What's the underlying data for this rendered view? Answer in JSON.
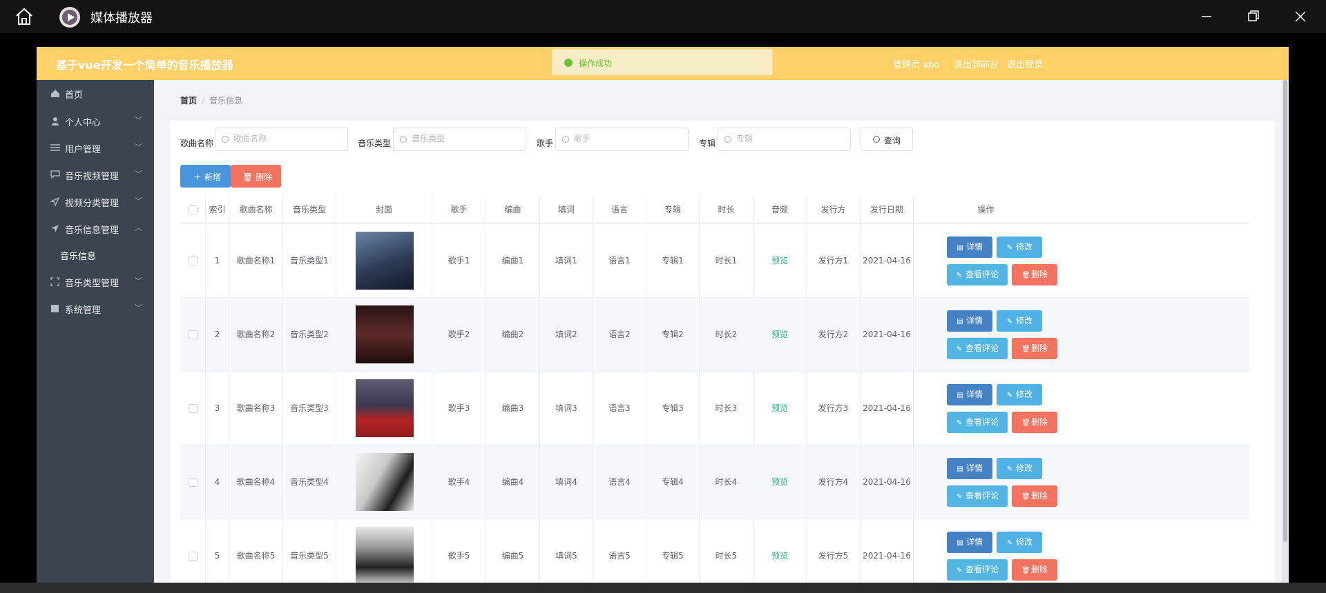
{
  "player": {
    "title": "媒体播放器"
  },
  "site": {
    "title": "基于vue开发一个简单的音乐播放器",
    "toast": "操作成功",
    "header_links": [
      "管理员 abo",
      "退出到前台",
      "退出登录"
    ]
  },
  "sidebar": {
    "items": [
      {
        "label": "首页",
        "icon": "home-icon"
      },
      {
        "label": "个人中心",
        "icon": "user-icon"
      },
      {
        "label": "用户管理",
        "icon": "sliders-icon"
      },
      {
        "label": "音乐视频管理",
        "icon": "chat-icon"
      },
      {
        "label": "视频分类管理",
        "icon": "send-icon"
      },
      {
        "label": "音乐信息管理",
        "icon": "send-icon"
      },
      {
        "label": "音乐类型管理",
        "icon": "expand-icon"
      },
      {
        "label": "系统管理",
        "icon": "grid-icon"
      }
    ],
    "active_sub": "音乐信息"
  },
  "breadcrumb": {
    "home": "首页",
    "current": "音乐信息"
  },
  "search": {
    "fields": [
      {
        "label": "歌曲名称",
        "placeholder": "歌曲名称"
      },
      {
        "label": "音乐类型",
        "placeholder": "音乐类型"
      },
      {
        "label": "歌手",
        "placeholder": "歌手"
      },
      {
        "label": "专辑",
        "placeholder": "专辑"
      }
    ],
    "button": "查询"
  },
  "toolbar": {
    "add": "新增",
    "delete": "删除"
  },
  "table": {
    "columns": [
      "索引",
      "歌曲名称",
      "音乐类型",
      "封面",
      "歌手",
      "编曲",
      "填词",
      "语言",
      "专辑",
      "时长",
      "音频",
      "发行方",
      "发行日期",
      "操作"
    ],
    "rows": [
      {
        "idx": "1",
        "song": "歌曲名称1",
        "type": "音乐类型1",
        "singer": "歌手1",
        "arr": "编曲1",
        "lyric": "填词1",
        "lang": "语言1",
        "album": "专辑1",
        "dur": "时长1",
        "audio": "预览",
        "pub": "发行方1",
        "date": "2021-04-16"
      },
      {
        "idx": "2",
        "song": "歌曲名称2",
        "type": "音乐类型2",
        "singer": "歌手2",
        "arr": "编曲2",
        "lyric": "填词2",
        "lang": "语言2",
        "album": "专辑2",
        "dur": "时长2",
        "audio": "预览",
        "pub": "发行方2",
        "date": "2021-04-16"
      },
      {
        "idx": "3",
        "song": "歌曲名称3",
        "type": "音乐类型3",
        "singer": "歌手3",
        "arr": "编曲3",
        "lyric": "填词3",
        "lang": "语言3",
        "album": "专辑3",
        "dur": "时长3",
        "audio": "预览",
        "pub": "发行方3",
        "date": "2021-04-16"
      },
      {
        "idx": "4",
        "song": "歌曲名称4",
        "type": "音乐类型4",
        "singer": "歌手4",
        "arr": "编曲4",
        "lyric": "填词4",
        "lang": "语言4",
        "album": "专辑4",
        "dur": "时长4",
        "audio": "预览",
        "pub": "发行方4",
        "date": "2021-04-16"
      },
      {
        "idx": "5",
        "song": "歌曲名称5",
        "type": "音乐类型5",
        "singer": "歌手5",
        "arr": "编曲5",
        "lyric": "填词5",
        "lang": "语言5",
        "album": "专辑5",
        "dur": "时长5",
        "audio": "预览",
        "pub": "发行方5",
        "date": "2021-04-16"
      }
    ],
    "actions": {
      "detail": "详情",
      "edit": "修改",
      "comments": "查看评论",
      "remove": "删除"
    }
  },
  "colors": {
    "header": "#fdd168",
    "sidebar": "#3c4450",
    "primary": "#4796db",
    "danger": "#f37260",
    "preview": "#27b48a"
  }
}
